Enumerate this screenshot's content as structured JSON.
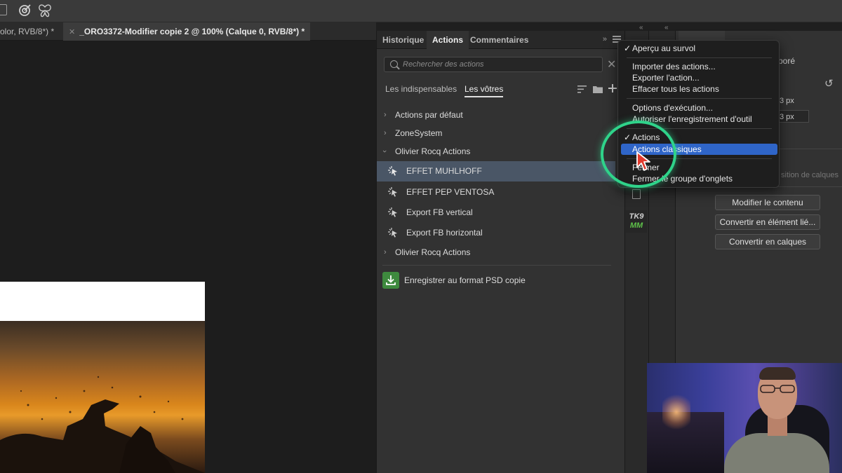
{
  "document_tabs": [
    {
      "label": "olor, RVB/8*) *",
      "active": false
    },
    {
      "label": "_ORO3372-Modifier copie 2 @ 100% (Calque 0, RVB/8*) *",
      "active": true
    }
  ],
  "panel": {
    "tabs": [
      "Historique",
      "Actions",
      "Commentaires"
    ],
    "active_tab": "Actions",
    "more_glyph": "»",
    "search": {
      "placeholder": "Rechercher des actions",
      "value": ""
    },
    "subtabs": [
      "Les indispensables",
      "Les vôtres"
    ],
    "active_subtab": "Les vôtres",
    "rows": [
      {
        "type": "set",
        "label": "Actions par défaut",
        "expanded": false
      },
      {
        "type": "set",
        "label": "ZoneSystem",
        "expanded": false
      },
      {
        "type": "set",
        "label": "Olivier Rocq Actions",
        "expanded": true
      },
      {
        "type": "action",
        "label": "EFFET MUHLHOFF",
        "selected": true
      },
      {
        "type": "action",
        "label": "EFFET PEP VENTOSA",
        "selected": false
      },
      {
        "type": "action",
        "label": "Export FB vertical",
        "selected": false
      },
      {
        "type": "action",
        "label": "Export FB horizontal",
        "selected": false
      },
      {
        "type": "set",
        "label": "Olivier Rocq Actions",
        "expanded": false
      }
    ],
    "save_psd_label": "Enregistrer au format PSD copie"
  },
  "flyout_menu": {
    "items": [
      {
        "label": "Aperçu au survol",
        "checked": true,
        "highlighted": false
      },
      {
        "label": "Importer des actions...",
        "checked": false,
        "highlighted": false
      },
      {
        "label": "Exporter l'action...",
        "checked": false,
        "highlighted": false
      },
      {
        "label": "Effacer tous les actions",
        "checked": false,
        "highlighted": false
      },
      {
        "label": "Options d'exécution...",
        "checked": false,
        "highlighted": false
      },
      {
        "label": "Autoriser l'enregistrement d'outil",
        "checked": false,
        "highlighted": false
      },
      {
        "label": "Actions",
        "checked": true,
        "highlighted": false
      },
      {
        "label": "Actions classiques",
        "checked": false,
        "highlighted": true
      },
      {
        "label": "Fermer",
        "checked": false,
        "highlighted": false
      },
      {
        "label": "Fermer le groupe d'onglets",
        "checked": false,
        "highlighted": false
      }
    ],
    "accent_color": "#2f65c8"
  },
  "properties": {
    "header_fragment": "poré",
    "value_1": "3 px",
    "value_2": "3 px",
    "composition_fragment": "sition de calques",
    "buttons": [
      "Modifier le contenu",
      "Convertir en élément lié...",
      "Convertir en calques"
    ]
  },
  "plugin_badge": {
    "line1": "TK9",
    "line2": "MM"
  },
  "highlight_ring_color": "#2fd38a",
  "icons": [
    "target-icon",
    "butterfly-icon",
    "search-icon",
    "close-icon",
    "sort-icon",
    "folder-icon",
    "add-icon",
    "panel-menu-icon",
    "reset-icon",
    "download-icon",
    "action-play-icon",
    "cursor-icon"
  ]
}
